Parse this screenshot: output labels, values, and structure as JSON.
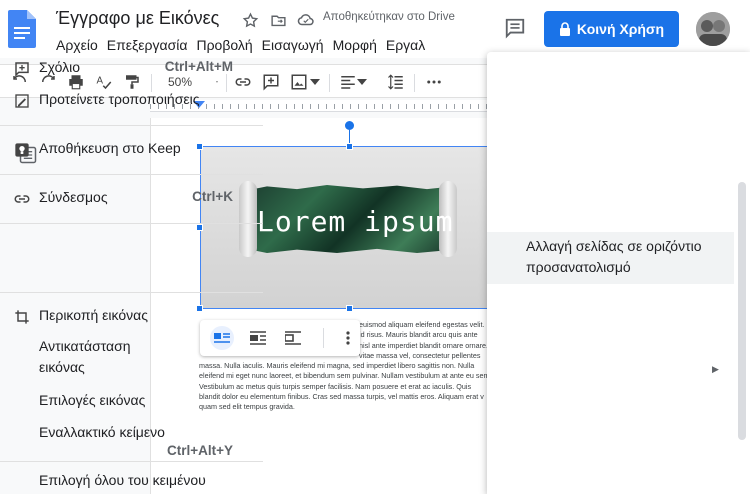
{
  "doc": {
    "title": "Έγγραφο με Εικόνες",
    "saved_status": "Αποθηκεύτηκαν στο Drive"
  },
  "menubar": {
    "items": [
      "Αρχείο",
      "Επεξεργασία",
      "Προβολή",
      "Εισαγωγή",
      "Μορφή",
      "Εργαλ"
    ]
  },
  "header": {
    "share_label": "Κοινή Χρήση"
  },
  "toolbar": {
    "zoom_value": "50%"
  },
  "image": {
    "text": "Lorem ipsum"
  },
  "body_text": [
    "euismod aliquam eleifend egestas velit. N",
    "id risus. Mauris blandit arcu quis ante",
    "nisl ante imperdiet blandit ornare ornare. Fusce ultri",
    "vitae massa vel, consectetur pellentes",
    "massa. Nulla iaculis. Mauris eleifend mi magna, sed imperdiet libero sagittis non. Nulla",
    "eleifend mi eget nunc laoreet, et bibendum sem pulvinar. Nullam vestibulum at ante eu sem",
    "Vestibulum ac metus quis turpis semper facilisis. Nam posuere et erat ac iaculis. Quis",
    "blandit dolor eu elementum finibus. Cras sed massa turpis, vel mattis eros. Aliquam erat v",
    "quam sed elit tempus gravida."
  ],
  "context_menu": {
    "items": [
      {
        "label": "Σχόλιο",
        "shortcut": "Ctrl+Alt+M",
        "icon": "add-comment-icon"
      },
      {
        "label": "Προτείνετε τροποποιήσεις",
        "shortcut": "",
        "icon": "suggest-edits-icon"
      },
      {
        "label": "Αποθήκευση στο Keep",
        "shortcut": "",
        "icon": "keep-icon"
      },
      {
        "label": "Σύνδεσμος",
        "shortcut": "Ctrl+K",
        "icon": "link-icon"
      },
      {
        "label_line1": "Αλλαγή σελίδας σε οριζόντιο",
        "label_line2": "προσανατολισμό",
        "shortcut": "",
        "icon": ""
      },
      {
        "label": "Περικοπή εικόνας",
        "shortcut": "",
        "icon": "crop-icon"
      },
      {
        "label_line1": "Αντικατάσταση",
        "label_line2": "εικόνας",
        "shortcut": "",
        "icon": ""
      },
      {
        "label": "Επιλογές εικόνας",
        "shortcut": "",
        "icon": ""
      },
      {
        "label": "Εναλλακτικό κείμενο",
        "shortcut": "Ctrl+Alt+Y",
        "icon": ""
      },
      {
        "label": "Επιλογή όλου του κειμένου",
        "shortcut": "",
        "icon": ""
      }
    ]
  },
  "colors": {
    "accent": "#1a73e8",
    "menu_highlight": "#f1f3f4"
  }
}
